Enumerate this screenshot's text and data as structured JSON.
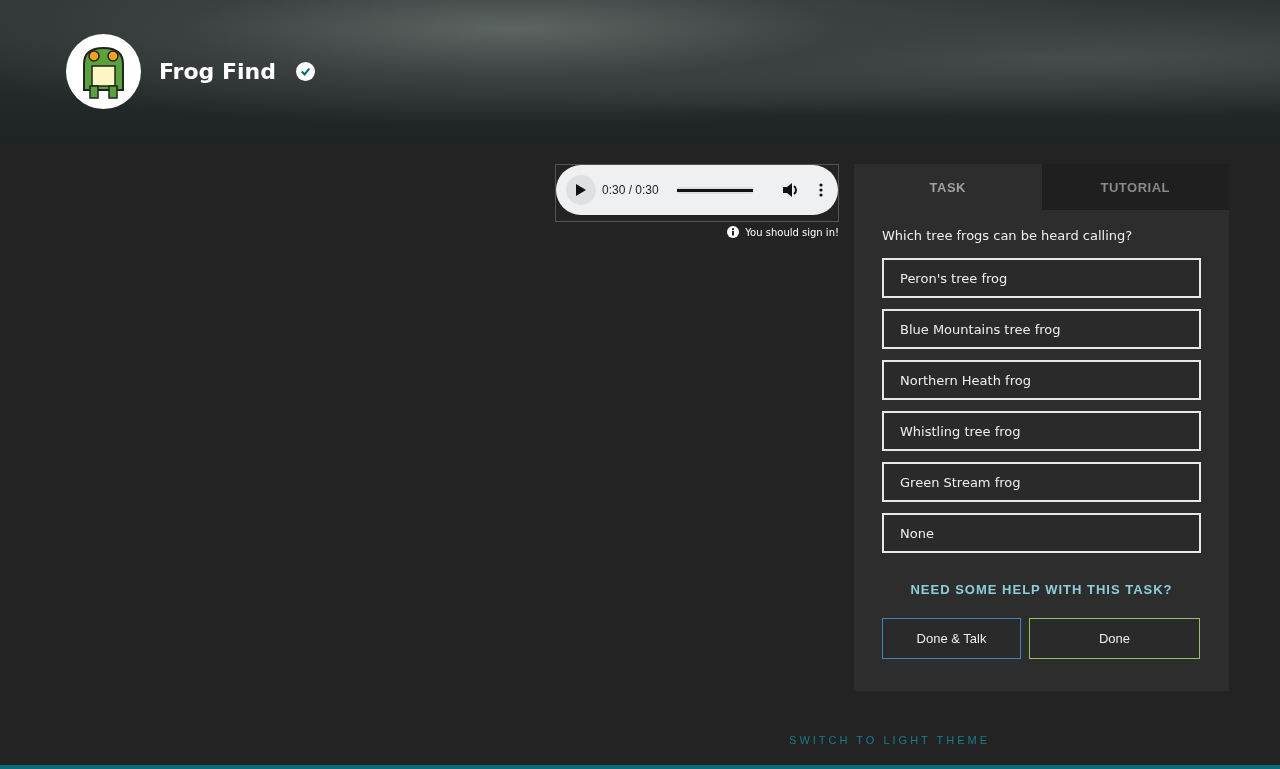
{
  "header": {
    "title": "Frog Find",
    "verified": true
  },
  "audio_player": {
    "time": "0:30 / 0:30",
    "level": 1
  },
  "notice": "You should sign in!",
  "tabs": [
    {
      "label": "TASK",
      "selected": true
    },
    {
      "label": "TUTORIAL",
      "selected": false
    }
  ],
  "question": "Which tree frogs can be heard calling?",
  "answers": [
    {
      "label": "Peron's tree frog",
      "selected": false
    },
    {
      "label": "Blue Mountains tree frog",
      "selected": false
    },
    {
      "label": "Northern Heath frog",
      "selected": false
    },
    {
      "label": "Whistling tree frog",
      "selected": false
    },
    {
      "label": "Green Stream frog",
      "selected": false
    },
    {
      "label": "None",
      "selected": false
    }
  ],
  "help_link": "NEED SOME HELP WITH THIS TASK?",
  "buttons": [
    {
      "label": "Done & Talk",
      "kind": "talk"
    },
    {
      "label": "Done",
      "kind": "done"
    }
  ],
  "footer_link": "SWITCH TO LIGHT THEME"
}
